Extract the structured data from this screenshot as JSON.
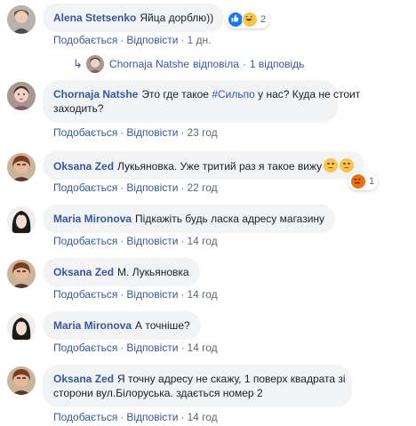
{
  "ui": {
    "like": "Подобається",
    "reply": "Відповісти",
    "sep": "·"
  },
  "comments": [
    {
      "author": "Alena Stetsenko",
      "text": "Яйца дорблю))",
      "time": "1 дн.",
      "reactions_count": "2"
    },
    {
      "author": "Chornaja Natshe",
      "text_pre": "Это где такое ",
      "hashtag": "#Сильпо",
      "text_post": " у нас? Куда не стоит",
      "text_line2": "заходить?",
      "time": "23 год"
    },
    {
      "author": "Oksana Zed",
      "text": "Лукьяновка. Уже тритий раз я такое вижу",
      "time": "22 год",
      "reactions_count": "1"
    },
    {
      "author": "Maria Mironova",
      "text": "Підкажіть будь ласка адресу магазину",
      "time": "14 год"
    },
    {
      "author": "Oksana Zed",
      "text": "М. Лукьяновка",
      "time": "14 год"
    },
    {
      "author": "Maria Mironova",
      "text": "А точніше?",
      "time": "14 год"
    },
    {
      "author": "Oksana Zed",
      "text": "Я точну адресу не скажу, 1 поверх квадрата зі",
      "text_line2": "сторони вул.Білоруська. здається номер 2",
      "time": "14 год"
    }
  ],
  "reply_summary": {
    "name": "Chornaja Natshe",
    "verb": "відповіла",
    "count": "1 відповідь"
  },
  "colors": {
    "link": "#385898",
    "bubble": "#f2f3f5",
    "meta": "#606770"
  },
  "icons": [
    "reply-arrow-icon",
    "like-reaction-icon",
    "haha-reaction-icon",
    "angry-reaction-icon",
    "sad-emoji-icon"
  ]
}
